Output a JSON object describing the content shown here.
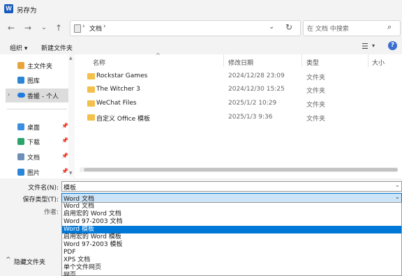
{
  "window": {
    "title": "另存为",
    "app_icon_letter": "W"
  },
  "nav": {
    "back_icon": "←",
    "forward_icon": "→",
    "recent_icon": "⌄",
    "up_icon": "↑",
    "address_path": "文档",
    "address_sep": "›",
    "dropdown_icon": "⌄",
    "refresh_icon": "↻",
    "search_placeholder": "在 文档 中搜索",
    "search_icon": "⌕"
  },
  "toolbar": {
    "organize_label": "组织 ▾",
    "new_folder_label": "新建文件夹",
    "view_icon": "☰",
    "view_dropdown": "▾",
    "help_icon": "?"
  },
  "sidebar": {
    "items": [
      {
        "label": "主文件夹",
        "icon": "home-icon",
        "color": "#e8a33a"
      },
      {
        "label": "图库",
        "icon": "gallery-icon",
        "color": "#2b86d8"
      },
      {
        "label": "香媛 - 个人",
        "icon": "cloud-icon",
        "color": "#1e7be0",
        "expand": "›"
      },
      {
        "label": "桌面",
        "icon": "desktop-icon",
        "color": "#3b8fe0",
        "pin": "📌"
      },
      {
        "label": "下载",
        "icon": "download-icon",
        "color": "#2aa36b",
        "pin": "📌"
      },
      {
        "label": "文档",
        "icon": "documents-icon",
        "color": "#6d8fb8",
        "pin": "📌"
      },
      {
        "label": "图片",
        "icon": "pictures-icon",
        "color": "#2b86d8",
        "pin": "📌"
      }
    ]
  },
  "file_list": {
    "columns": {
      "name": "名称",
      "date": "修改日期",
      "type": "类型",
      "size": "大小"
    },
    "sort_indicator": "^",
    "rows": [
      {
        "name": "Rockstar Games",
        "date": "2024/12/28 23:09",
        "type": "文件夹"
      },
      {
        "name": "The Witcher 3",
        "date": "2024/12/30 15:25",
        "type": "文件夹"
      },
      {
        "name": "WeChat Files",
        "date": "2025/1/2 10:29",
        "type": "文件夹"
      },
      {
        "name": "自定义 Office 模板",
        "date": "2025/1/3 9:36",
        "type": "文件夹"
      }
    ]
  },
  "form": {
    "filename_label": "文件名(N):",
    "filename_value": "模板",
    "savetype_label": "保存类型(T):",
    "savetype_value": "Word 文档",
    "author_label": "作者:",
    "dropdown_icon": "⌄"
  },
  "savetype_options": [
    {
      "label": "Word 文档",
      "selected": false
    },
    {
      "label": "启用宏的 Word 文档",
      "selected": false
    },
    {
      "label": "Word 97-2003 文档",
      "selected": false
    },
    {
      "label": "Word 模板",
      "selected": true
    },
    {
      "label": "启用宏的 Word 模板",
      "selected": false
    },
    {
      "label": "Word 97-2003 模板",
      "selected": false
    },
    {
      "label": "PDF",
      "selected": false
    },
    {
      "label": "XPS 文档",
      "selected": false
    },
    {
      "label": "单个文件网页",
      "selected": false
    },
    {
      "label": "网页",
      "selected": false
    }
  ],
  "footer": {
    "hide_folders_label": "隐藏文件夹",
    "hide_chevron": "^"
  }
}
